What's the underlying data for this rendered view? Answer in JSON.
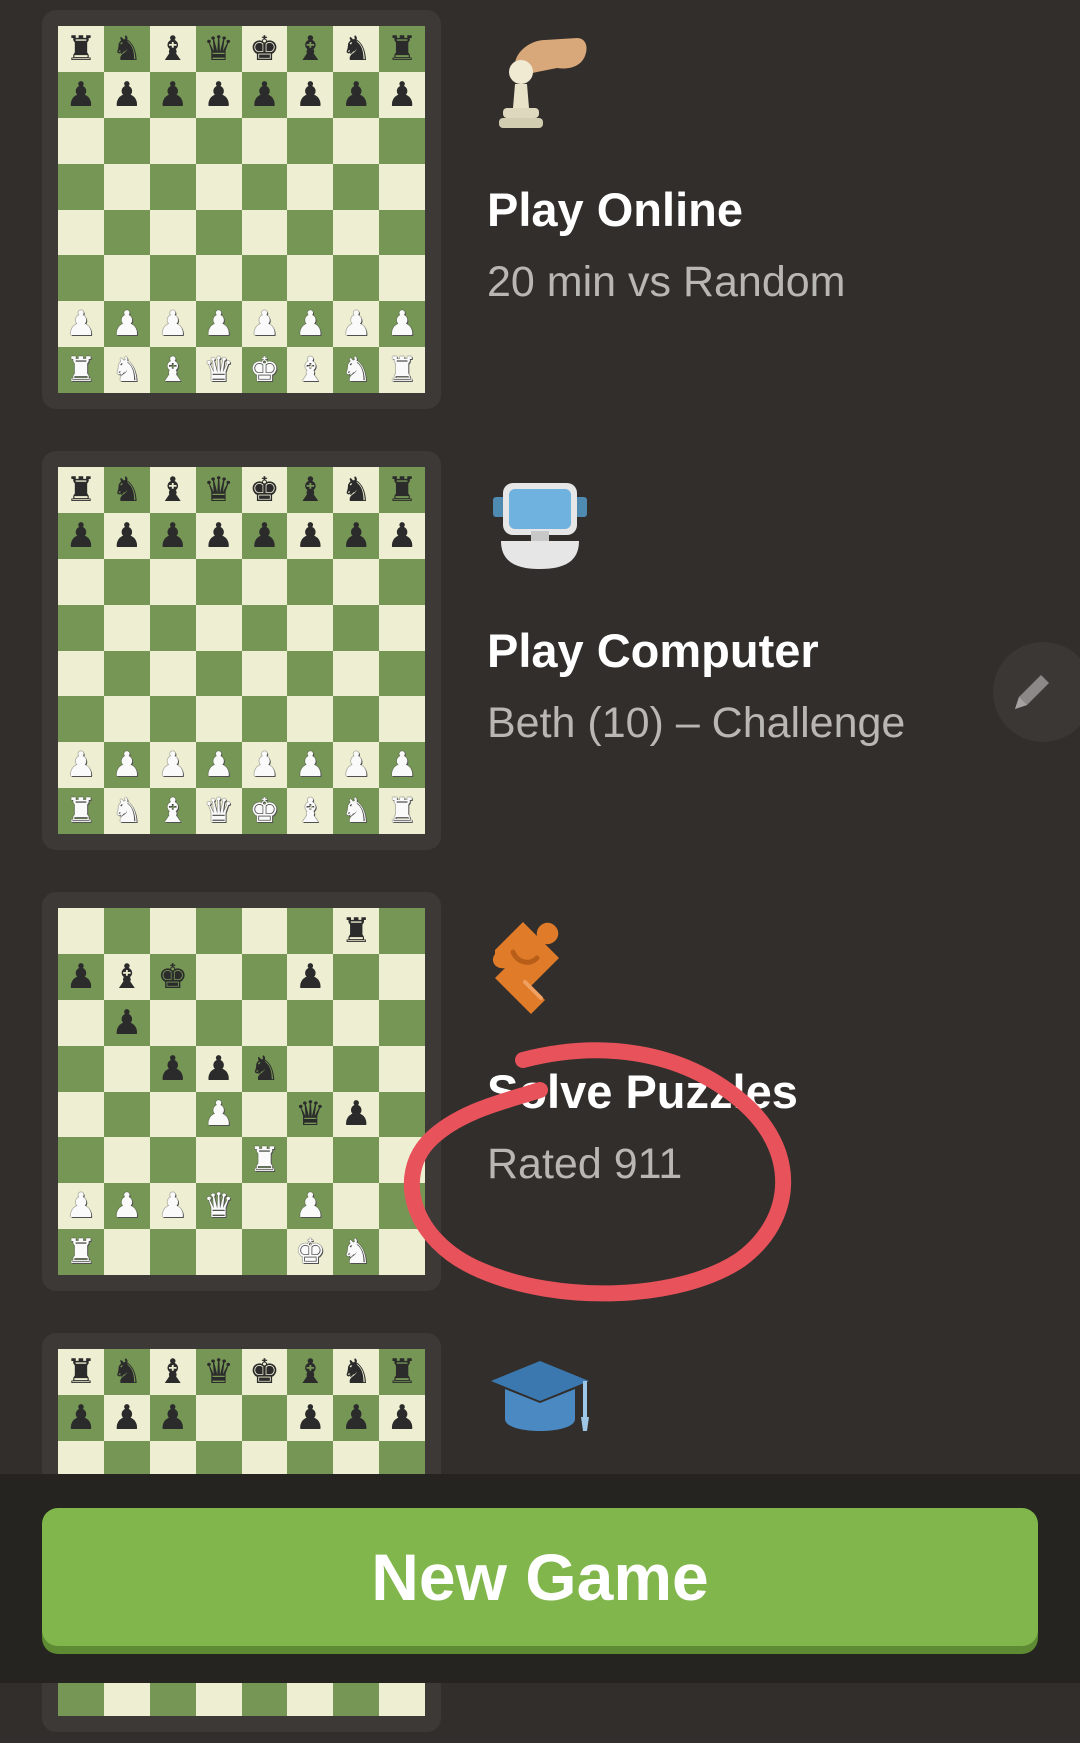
{
  "cards": [
    {
      "title": "Play Online",
      "subtitle": "20 min vs Random",
      "icon": "hand-pawn-icon",
      "position": [
        "rnbqkbnr",
        "pppppppp",
        "........",
        "........",
        "........",
        "........",
        "PPPPPPPP",
        "RNBQKBNR"
      ]
    },
    {
      "title": "Play Computer",
      "subtitle": "Beth (10) – Challenge",
      "icon": "computer-robot-icon",
      "position": [
        "rnbqkbnr",
        "pppppppp",
        "........",
        "........",
        "........",
        "........",
        "PPPPPPPP",
        "RNBQKBNR"
      ]
    },
    {
      "title": "Solve Puzzles",
      "subtitle": "Rated 911",
      "icon": "puzzle-piece-icon",
      "position": [
        "......r.",
        "pbk..p..",
        ".p......",
        "..ppn...",
        "...P.qp.",
        "....R...",
        "PPPQ.P..",
        "R....KN."
      ]
    },
    {
      "title": "",
      "subtitle": "",
      "icon": "graduation-cap-icon",
      "position": [
        "rnbqkbnr",
        "ppp..ppp",
        "........",
        "........",
        "........",
        "........",
        "........",
        "........"
      ]
    }
  ],
  "edit_button": {
    "icon": "pencil-icon"
  },
  "footer": {
    "new_game_label": "New Game"
  },
  "colors": {
    "background": "#312e2b",
    "light_square": "#eeeed2",
    "dark_square": "#769656",
    "accent_green": "#81b64c",
    "annotation_red": "#e8525a"
  }
}
